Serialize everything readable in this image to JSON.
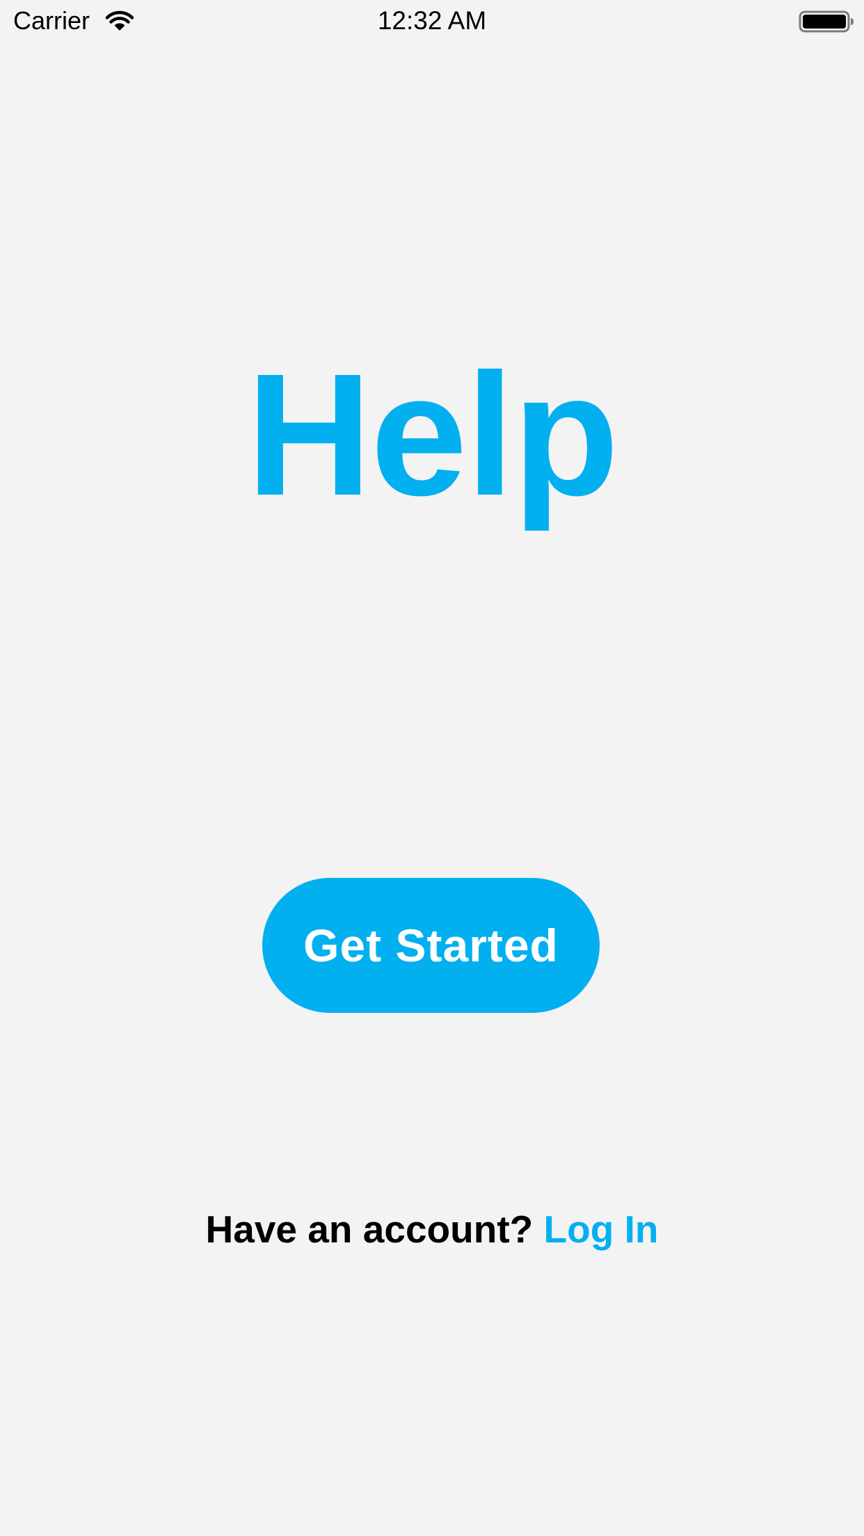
{
  "status_bar": {
    "carrier": "Carrier",
    "time": "12:32 AM",
    "wifi_icon": "wifi-icon",
    "battery_icon": "battery-full-icon",
    "battery_level": 1.0
  },
  "app": {
    "title": "Help",
    "accent_color": "#03b0ef",
    "background_color": "#f3f3f3"
  },
  "actions": {
    "get_started_label": "Get Started",
    "account_prompt": "Have an account?",
    "login_label": "Log In"
  }
}
